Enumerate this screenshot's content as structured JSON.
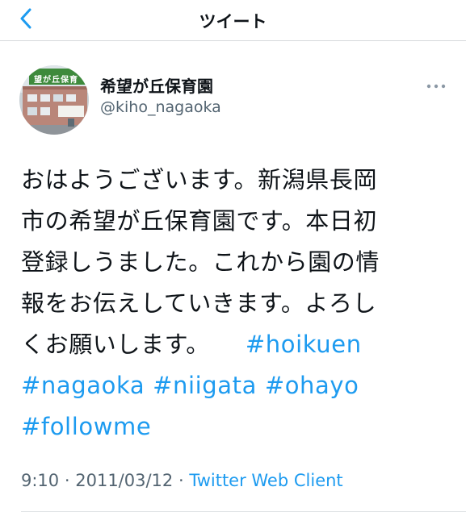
{
  "header": {
    "title": "ツイート",
    "back_icon": "chevron-left-icon"
  },
  "colors": {
    "accent": "#1d9bf0",
    "text": "#0f1419",
    "secondary": "#536471"
  },
  "author": {
    "display_name": "希望が丘保育園",
    "handle": "@kiho_nagaoka",
    "avatar": "building-photo-avatar",
    "avatar_sign_text": "望が丘保育"
  },
  "tweet": {
    "lines": [
      "おはようございます。新潟県長岡",
      "市の希望が丘保育園です。本日初",
      "登録しうました。これから園の情",
      "報をお伝えしていきます。よろし",
      "くお願いします。"
    ],
    "hashtags": [
      "#hoikuen",
      "#nagaoka",
      "#niigata",
      "#ohayo",
      "#followme"
    ]
  },
  "meta": {
    "time": "9:10",
    "date": "2011/03/12",
    "separator": "·",
    "client": "Twitter Web Client"
  },
  "menu": {
    "more_icon": "more-dots-icon"
  }
}
